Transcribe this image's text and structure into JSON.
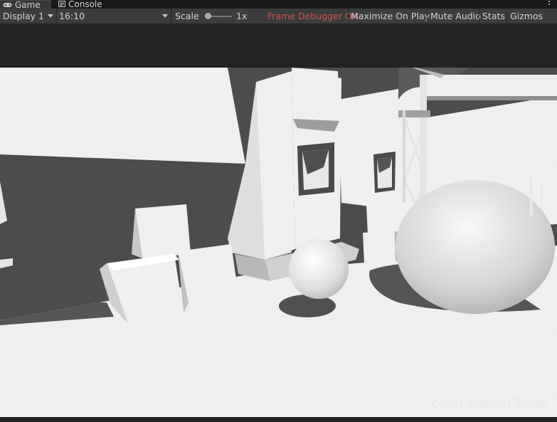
{
  "tabs": [
    {
      "label": "Game",
      "icon": "gamepad-icon",
      "active": true
    },
    {
      "label": "Console",
      "icon": "console-icon",
      "active": false
    }
  ],
  "toolbar": {
    "display": "Display 1",
    "aspect": "16:10",
    "scale_label": "Scale",
    "scale_value": "1x",
    "scale_fraction": 0.0,
    "frame_debugger": "Frame Debugger On",
    "maximize_on_play": "Maximize On Play",
    "mute_audio": "Mute Audio",
    "stats": "Stats",
    "gizmos": "Gizmos"
  },
  "colors": {
    "active_toggle": "#d2524e",
    "toolbar_bg": "#3c3c3c",
    "tabbar_bg": "#191919",
    "scene_bg": "#4a4a4a",
    "scene_surface": "#f0f0f0"
  },
  "watermark": "CSDN @玻璃杯里的鲸"
}
